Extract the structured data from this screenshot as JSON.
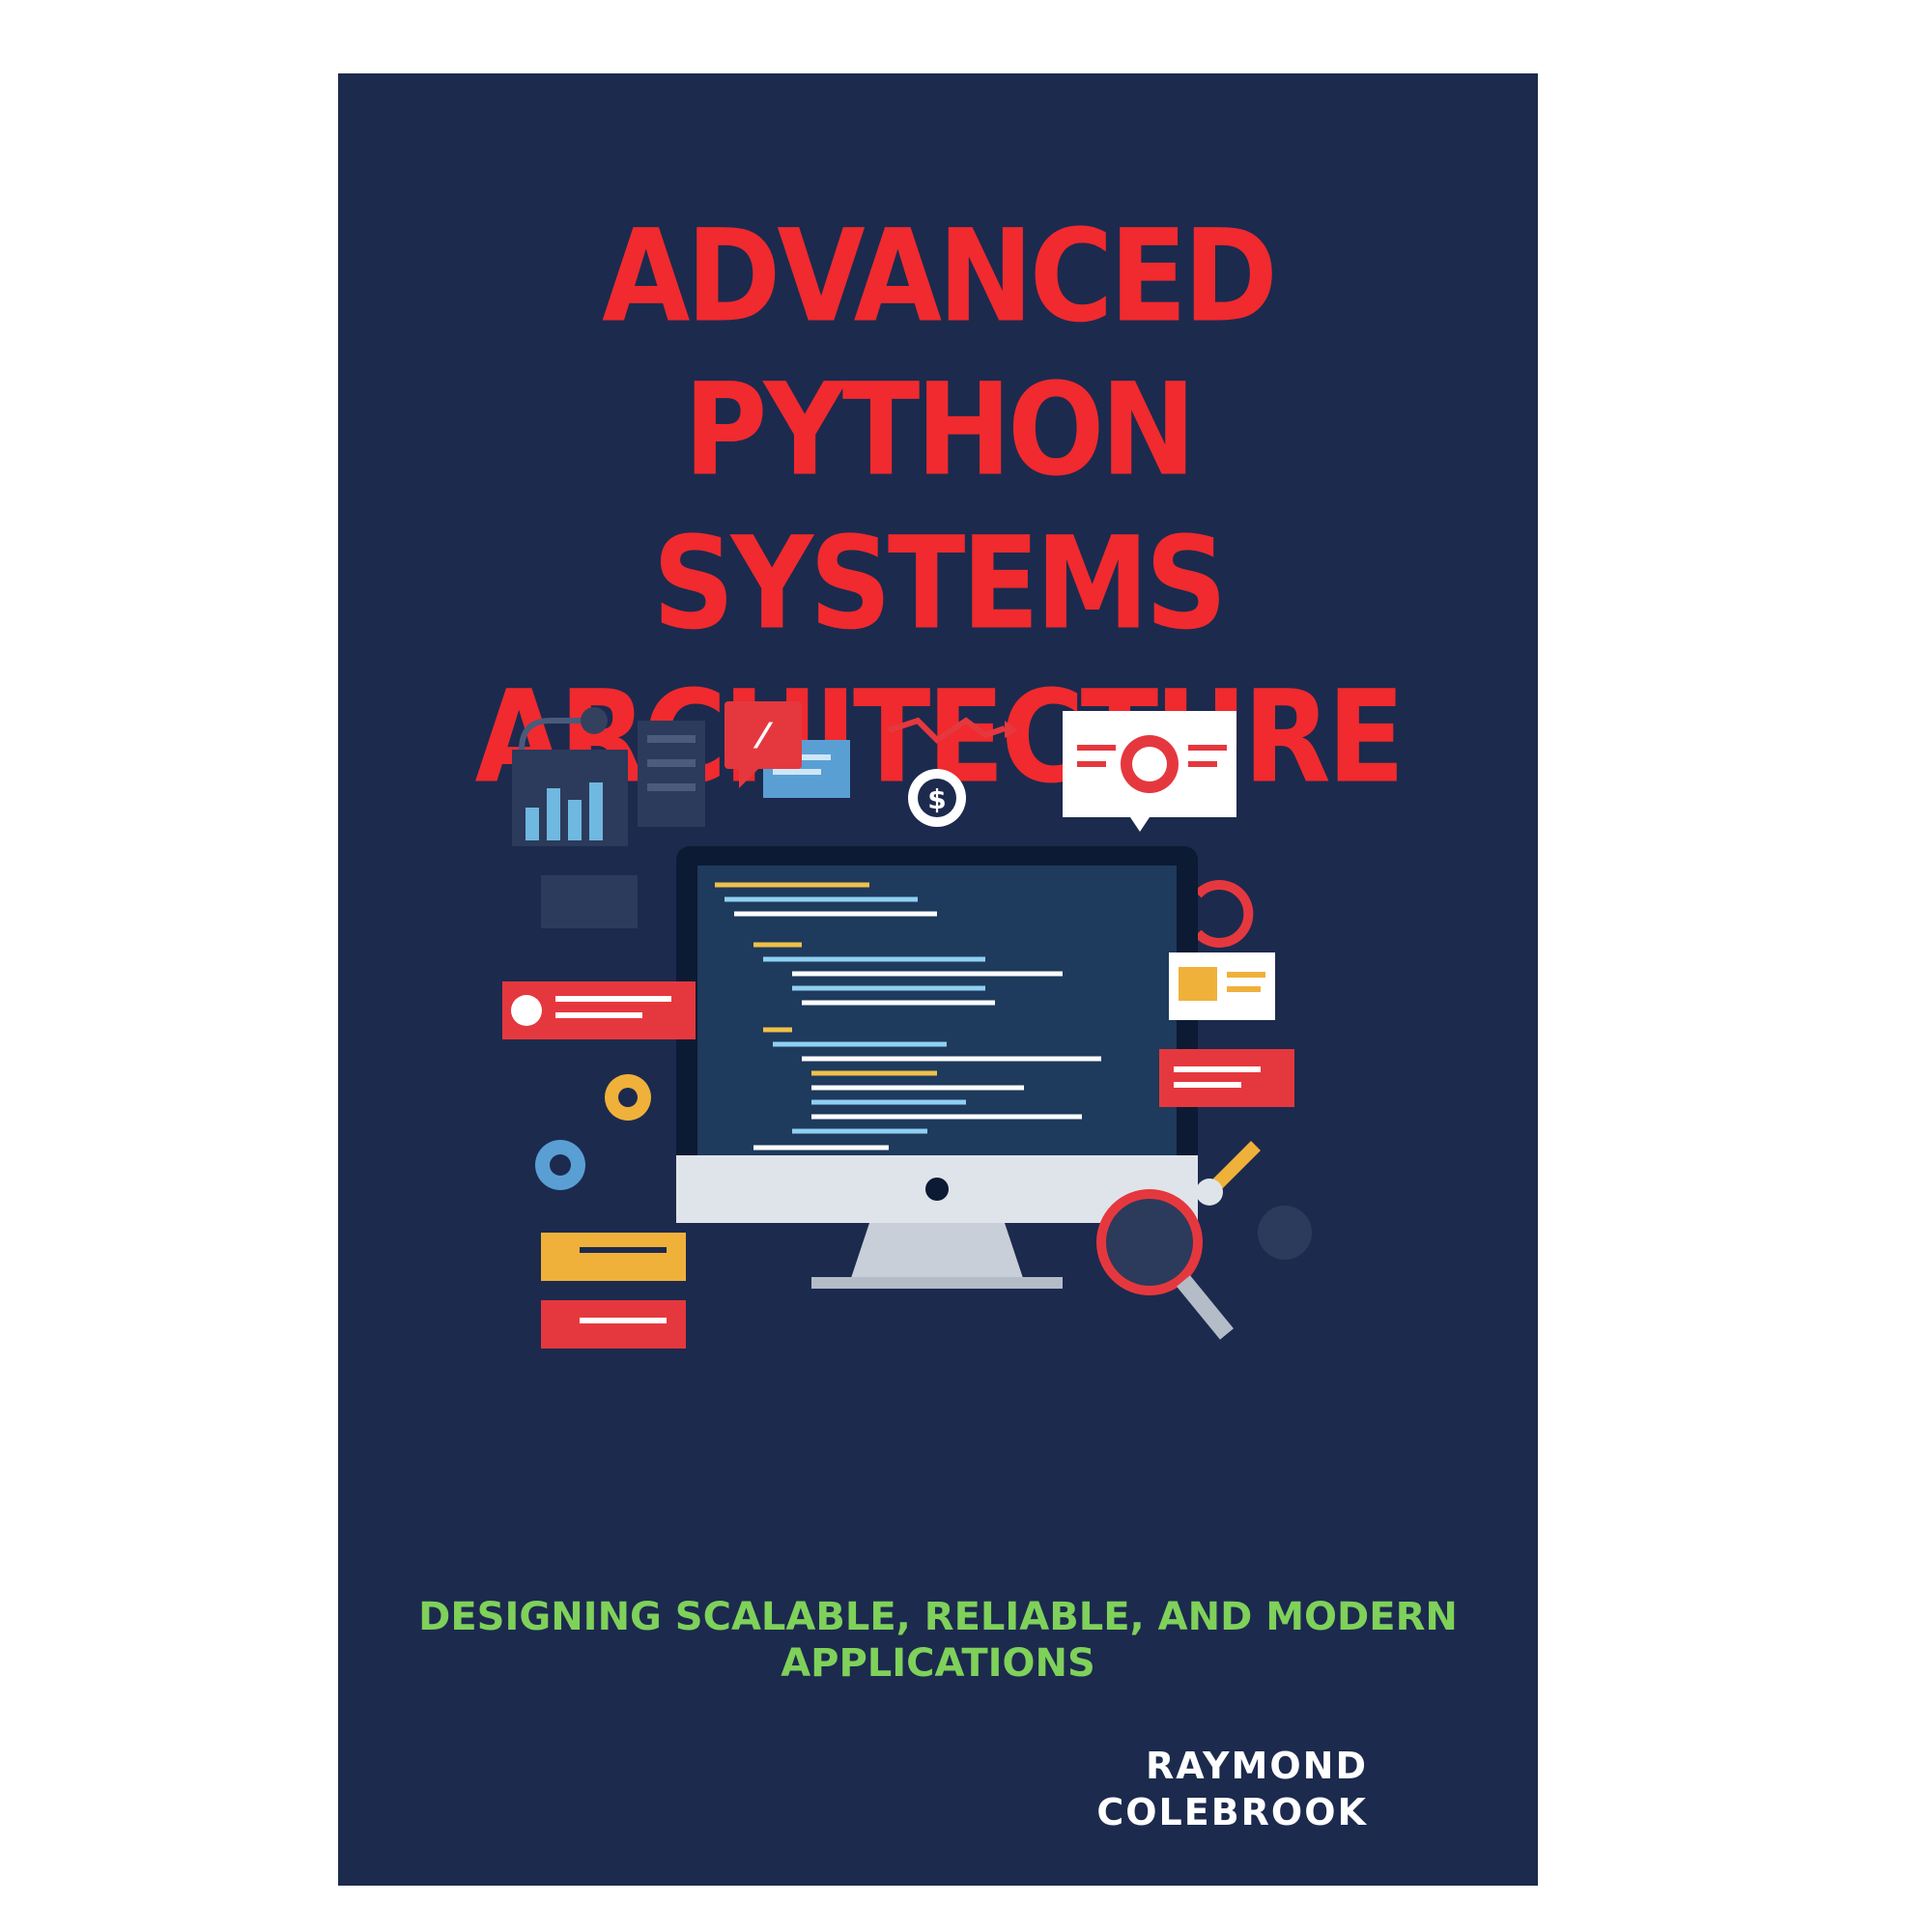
{
  "book": {
    "title_lines": [
      "ADVANCED PYTHON",
      "SYSTEMS",
      "ARCHITECTURE"
    ],
    "subtitle": "DESIGNING SCALABLE, RELIABLE, AND MODERN APPLICATIONS",
    "author_lines": [
      "RAYMOND",
      "COLEBROOK"
    ]
  },
  "colors": {
    "cover_background": "#1c2a4e",
    "title": "#f02a2e",
    "subtitle": "#7fd15a",
    "author": "#ffffff"
  },
  "illustration": {
    "icons": [
      "bar-chart-icon",
      "code-chat-icon",
      "dollar-gear-icon",
      "trend-arrow-icon",
      "target-card-icon",
      "refresh-arrows-icon",
      "image-card-icon",
      "gear-icon",
      "wrench-icon",
      "magnifier-icon",
      "monitor-icon"
    ]
  }
}
